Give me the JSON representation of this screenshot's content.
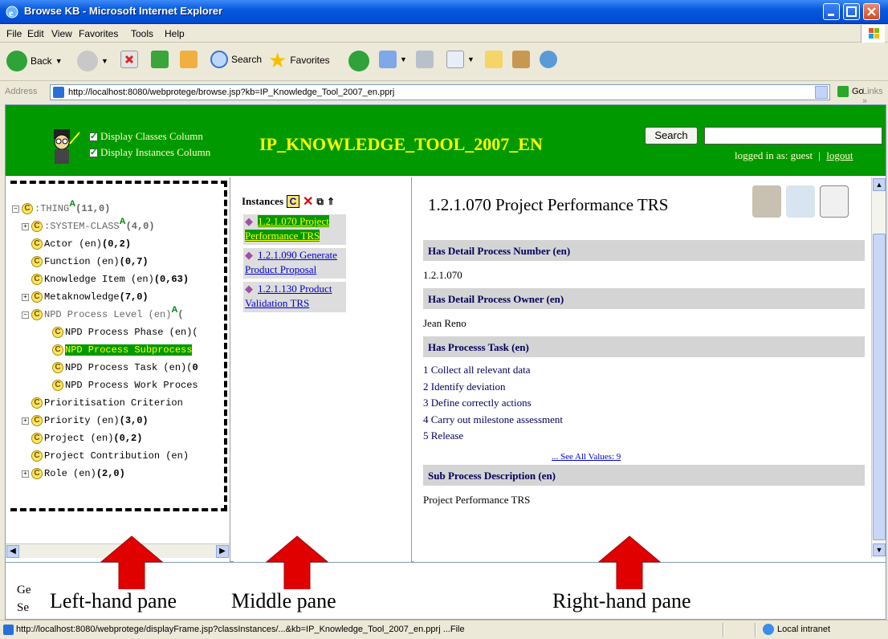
{
  "window": {
    "title": "Browse KB - Microsoft Internet Explorer"
  },
  "menu": [
    "File",
    "Edit",
    "View",
    "Favorites",
    "Tools",
    "Help"
  ],
  "toolbar": {
    "back": "Back",
    "search": "Search",
    "favorites": "Favorites"
  },
  "address": {
    "label": "Address",
    "url": "http://localhost:8080/webprotege/browse.jsp?kb=IP_Knowledge_Tool_2007_en.pprj",
    "go": "Go",
    "links": "Links"
  },
  "header": {
    "display_classes": "Display Classes Column",
    "display_instances": "Display Instances Column",
    "kb_name": "IP_KNOWLEDGE_TOOL_2007_EN",
    "search_button": "Search",
    "logged_in": "logged in as: guest",
    "sep": "|",
    "logout": "logout"
  },
  "tree": [
    {
      "label": ":THING",
      "sup": "A",
      "count": "(11,0)"
    },
    {
      "label": ":SYSTEM-CLASS",
      "sup": "A",
      "count": "(4,0)"
    },
    {
      "label": "Actor (en)",
      "count": "(0,2)"
    },
    {
      "label": "Function (en)",
      "count": "(0,7)"
    },
    {
      "label": "Knowledge Item (en)",
      "count": "(0,63)"
    },
    {
      "label": "Metaknowledge",
      "count": "(7,0)"
    },
    {
      "label": "NPD Process Level (en)",
      "sup": "A",
      "count": "("
    },
    {
      "label": "NPD Process Phase (en)(",
      "count": ""
    },
    {
      "label": "NPD Process Subprocess",
      "count": ""
    },
    {
      "label": "NPD Process Task (en)(",
      "count": "0"
    },
    {
      "label": "NPD Process Work Proces",
      "count": ""
    },
    {
      "label": "Prioritisation Criterion",
      "count": ""
    },
    {
      "label": "Priority (en)",
      "count": "(3,0)"
    },
    {
      "label": "Project (en)",
      "count": "(0,2)"
    },
    {
      "label": "Project Contribution (en)",
      "count": ""
    },
    {
      "label": "Role (en)",
      "count": "(2,0)"
    }
  ],
  "middle": {
    "header": "Instances",
    "c_icon": "C",
    "instances": [
      {
        "l1": "1.2.1.070 Project",
        "l2": "Performance TRS"
      },
      {
        "l1": "1.2.1.090 Generate",
        "l2": "Product Proposal"
      },
      {
        "l1": "1.2.1.130 Product",
        "l2": "Validation TRS"
      }
    ]
  },
  "right": {
    "title": "1.2.1.070 Project Performance TRS",
    "slot1": "Has Detail Process Number (en)",
    "val1": "1.2.1.070",
    "slot2": "Has Detail Process Owner (en)",
    "val2": "Jean Reno",
    "slot3": "Has Processs Task (en)",
    "tasks": [
      "1 Collect all relevant data",
      "2 Identify deviation",
      "3 Define correctly actions",
      "4 Carry out milestone assessment",
      "5 Release"
    ],
    "see_all": "... See All Values: 9",
    "slot4": "Sub Process Description (en)",
    "val4": "Project Performance TRS"
  },
  "bottom": {
    "frag1": "Ge",
    "frag2": "Se"
  },
  "pane_labels": {
    "left": "Left-hand pane",
    "middle": "Middle pane",
    "right": "Right-hand pane"
  },
  "status": {
    "text": "http://localhost:8080/webprotege/displayFrame.jsp?classInstances/...&kb=IP_Knowledge_Tool_2007_en.pprj ...File",
    "zone": "Local intranet"
  },
  "colors": {
    "header_green": "#009900",
    "kb_yellow": "#ffff00",
    "arrow_red": "#e00000",
    "slot_gray": "#d4d4d4"
  }
}
